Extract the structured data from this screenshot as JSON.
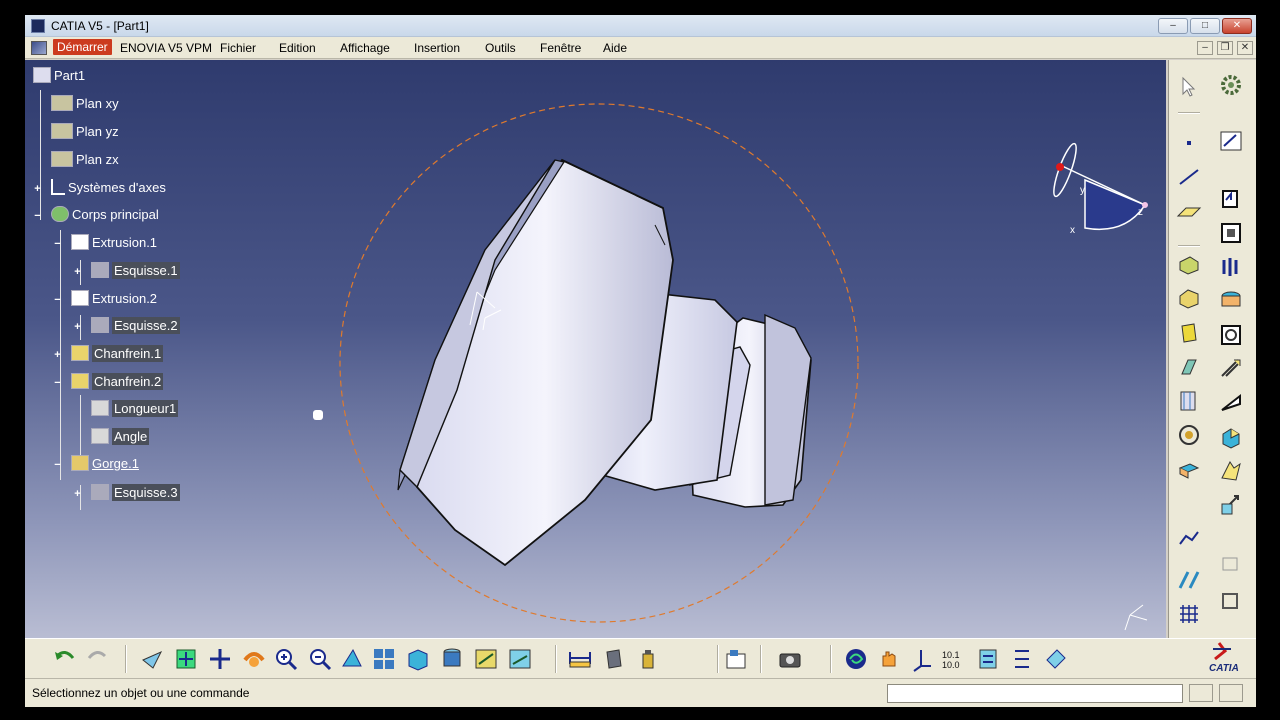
{
  "window": {
    "title": "CATIA V5 - [Part1]",
    "min_label": "–",
    "max_label": "□",
    "close_label": "✕",
    "mdi_min_label": "–",
    "mdi_restore_label": "❐",
    "mdi_close_label": "✕"
  },
  "menubar": {
    "items": [
      {
        "label": "Démarrer"
      },
      {
        "label": "ENOVIA V5 VPM"
      },
      {
        "label": "Fichier"
      },
      {
        "label": "Edition"
      },
      {
        "label": "Affichage"
      },
      {
        "label": "Insertion"
      },
      {
        "label": "Outils"
      },
      {
        "label": "Fenêtre"
      },
      {
        "label": "Aide"
      }
    ]
  },
  "tree": {
    "nodes": [
      {
        "label": "Part1",
        "icon": "part-icon"
      },
      {
        "label": "Plan xy",
        "icon": "plane-icon"
      },
      {
        "label": "Plan yz",
        "icon": "plane-icon"
      },
      {
        "label": "Plan zx",
        "icon": "plane-icon"
      },
      {
        "label": "Systèmes d'axes",
        "icon": "axis-system-icon"
      },
      {
        "label": "Corps principal",
        "icon": "body-icon"
      },
      {
        "label": "Extrusion.1",
        "icon": "pad-icon"
      },
      {
        "label": "Esquisse.1",
        "icon": "sketch-icon"
      },
      {
        "label": "Extrusion.2",
        "icon": "pad-icon"
      },
      {
        "label": "Esquisse.2",
        "icon": "sketch-icon"
      },
      {
        "label": "Chanfrein.1",
        "icon": "chamfer-icon"
      },
      {
        "label": "Chanfrein.2",
        "icon": "chamfer-icon"
      },
      {
        "label": "Longueur1",
        "icon": "parameter-icon"
      },
      {
        "label": "Angle",
        "icon": "parameter-icon"
      },
      {
        "label": "Gorge.1",
        "icon": "groove-icon"
      },
      {
        "label": "Esquisse.3",
        "icon": "sketch-icon"
      }
    ]
  },
  "compass": {
    "x_label": "x",
    "y_label": "y",
    "z_label": "z"
  },
  "status": {
    "message": "Sélectionnez un objet ou une commande",
    "command_value": ""
  },
  "logo": {
    "text": "CATIA"
  },
  "colors": {
    "viewport_top": "#2f3b6e",
    "viewport_bottom": "#b9bdd3",
    "accent": "#cc3b1f",
    "part": "#e4e5f4"
  }
}
